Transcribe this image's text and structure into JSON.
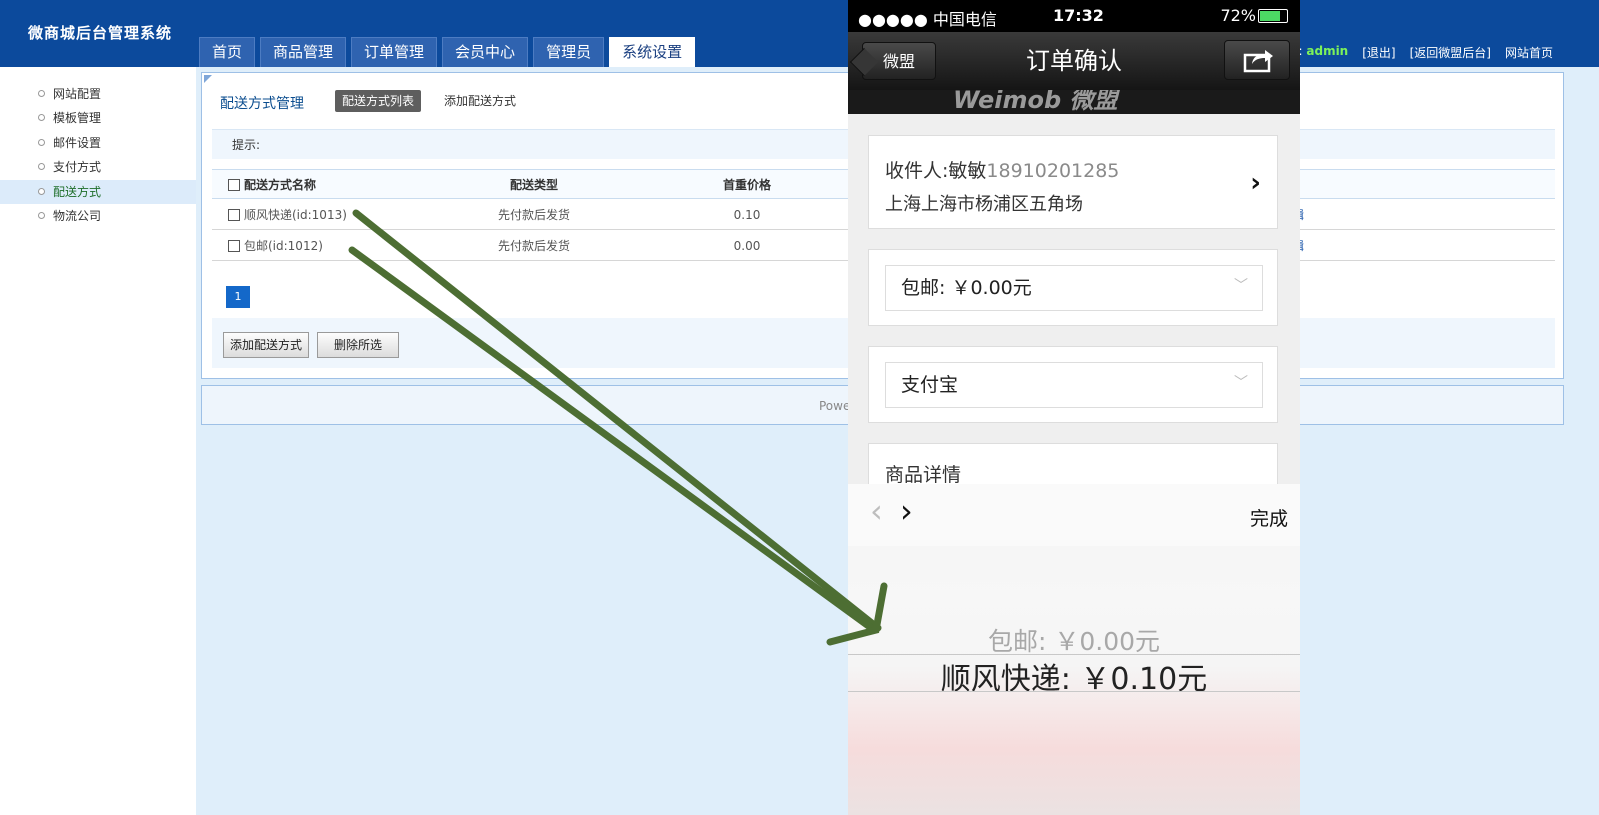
{
  "admin": {
    "brand": "微商城后台管理系统",
    "nav": [
      "首页",
      "商品管理",
      "订单管理",
      "会员中心",
      "管理员",
      "系统设置"
    ],
    "active_nav": "系统设置",
    "topright": {
      "prefix": ":",
      "user": "admin",
      "logout": "[退出]",
      "back": "[返回微盟后台]",
      "home": "网站首页"
    },
    "sidebar": [
      {
        "label": "网站配置"
      },
      {
        "label": "模板管理"
      },
      {
        "label": "邮件设置"
      },
      {
        "label": "支付方式"
      },
      {
        "label": "配送方式",
        "active": true
      },
      {
        "label": "物流公司"
      }
    ],
    "panel": {
      "title": "配送方式管理",
      "tab_active": "配送方式列表",
      "tab_add": "添加配送方式",
      "tip": "提示:"
    },
    "table": {
      "headers": {
        "name": "配送方式名称",
        "type": "配送类型",
        "price": "首重价格"
      },
      "rows": [
        {
          "name": "顺风快递(id:1013)",
          "type": "先付款后发货",
          "price": "0.10",
          "action": "辑"
        },
        {
          "name": "包邮(id:1012)",
          "type": "先付款后发货",
          "price": "0.00",
          "action": "辑"
        }
      ]
    },
    "page": "1",
    "buttons": {
      "add": "添加配送方式",
      "delete": "删除所选"
    },
    "footer": "Powe"
  },
  "phone": {
    "status": {
      "carrier": "●●●●● 中国电信",
      "time": "17:32",
      "battery": "72%"
    },
    "nav": {
      "back": "微盟",
      "title": "订单确认"
    },
    "banner": "Weimob 微盟",
    "address": {
      "label": "收件人:",
      "name": "敏敏",
      "phone": "18910201285",
      "line": "上海上海市杨浦区五角场"
    },
    "shipping_select": "包邮: ￥0.00元",
    "payment_select": "支付宝",
    "detail_label": "商品详情",
    "picker": {
      "done": "完成",
      "options": [
        "包邮: ￥0.00元",
        "顺风快递: ￥0.10元"
      ]
    }
  },
  "colors": {
    "header_blue": "#0c4a9c",
    "arrow_green": "#4d6e33",
    "active_user": "#7df25a"
  }
}
